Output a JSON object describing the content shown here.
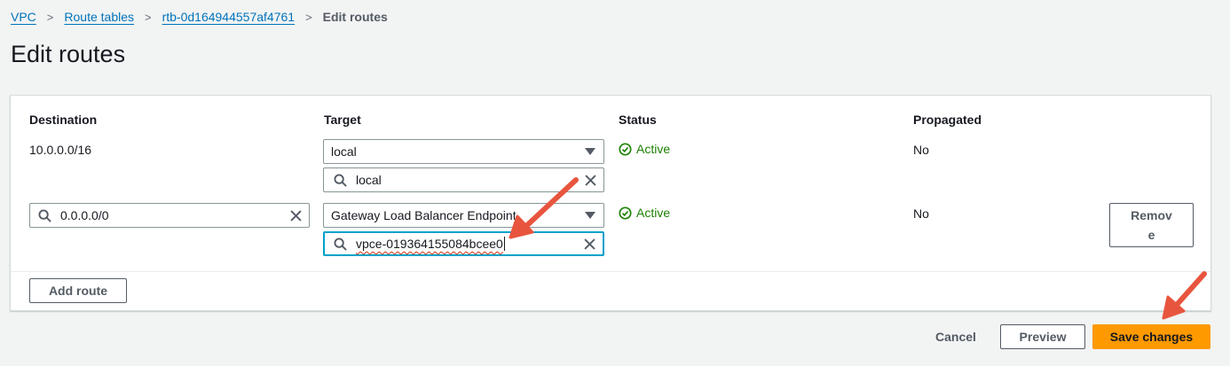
{
  "breadcrumb": {
    "items": [
      "VPC",
      "Route tables",
      "rtb-0d164944557af4761"
    ],
    "current": "Edit routes",
    "separator": ">"
  },
  "page": {
    "title": "Edit routes"
  },
  "table": {
    "headers": {
      "destination": "Destination",
      "target": "Target",
      "status": "Status",
      "propagated": "Propagated"
    },
    "rows": [
      {
        "destination": "10.0.0.0/16",
        "target_select": "local",
        "target_search": "local",
        "status": "Active",
        "propagated": "No"
      },
      {
        "destination_input": "0.0.0.0/0",
        "target_select": "Gateway Load Balancer Endpoint",
        "target_search": "vpce-019364155084bcee0",
        "status": "Active",
        "propagated": "No",
        "remove_label_line1": "Remov",
        "remove_label_line2": "e"
      }
    ]
  },
  "buttons": {
    "add_route": "Add route",
    "cancel": "Cancel",
    "preview": "Preview",
    "save": "Save changes"
  },
  "colors": {
    "link": "#0073bb",
    "status_active": "#1d8102",
    "primary_button": "#ff9900",
    "focus_border": "#00a1c9",
    "annotation_arrow": "#e8553e"
  },
  "icons": [
    "search-icon",
    "clear-icon",
    "caret-down-icon",
    "status-success-icon"
  ]
}
